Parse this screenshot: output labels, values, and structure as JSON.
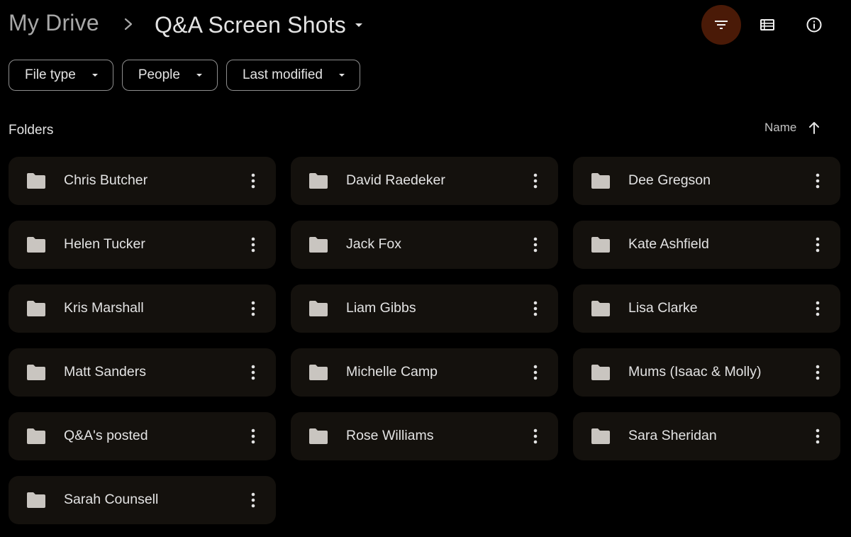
{
  "breadcrumb": {
    "root": "My Drive",
    "current": "Q&A Screen Shots"
  },
  "toolbar": {
    "filter_icon": "filter-icon",
    "list_view_icon": "list-view-icon",
    "info_icon": "info-icon",
    "filter_active_color": "#4a1a07"
  },
  "chips": [
    {
      "label": "File type"
    },
    {
      "label": "People"
    },
    {
      "label": "Last modified"
    }
  ],
  "folders_section": {
    "title": "Folders",
    "sort_label": "Name",
    "sort_direction": "ascending"
  },
  "folders": [
    {
      "name": "Chris Butcher"
    },
    {
      "name": "David Raedeker"
    },
    {
      "name": "Dee Gregson"
    },
    {
      "name": "Helen Tucker"
    },
    {
      "name": "Jack Fox"
    },
    {
      "name": "Kate Ashfield"
    },
    {
      "name": "Kris Marshall"
    },
    {
      "name": "Liam Gibbs"
    },
    {
      "name": "Lisa Clarke"
    },
    {
      "name": "Matt Sanders"
    },
    {
      "name": "Michelle Camp"
    },
    {
      "name": "Mums (Isaac & Molly)"
    },
    {
      "name": "Q&A's posted"
    },
    {
      "name": "Rose Williams"
    },
    {
      "name": "Sara Sheridan"
    },
    {
      "name": "Sarah Counsell"
    }
  ]
}
